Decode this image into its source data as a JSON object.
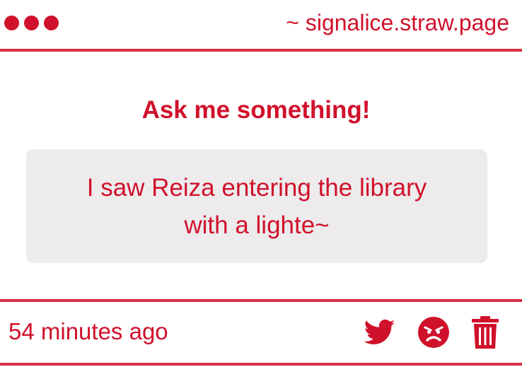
{
  "header": {
    "url": "~ signalice.straw.page"
  },
  "main": {
    "title": "Ask me something!",
    "question_line1": "I saw Reiza entering the library",
    "question_line2": "with a lighte~"
  },
  "footer": {
    "timestamp": "54 minutes ago",
    "icons": [
      "twitter-icon",
      "angry-face-icon",
      "trash-icon"
    ]
  },
  "colors": {
    "accent": "#d0112b",
    "card_bg": "#edebec",
    "background": "#ffffff"
  }
}
